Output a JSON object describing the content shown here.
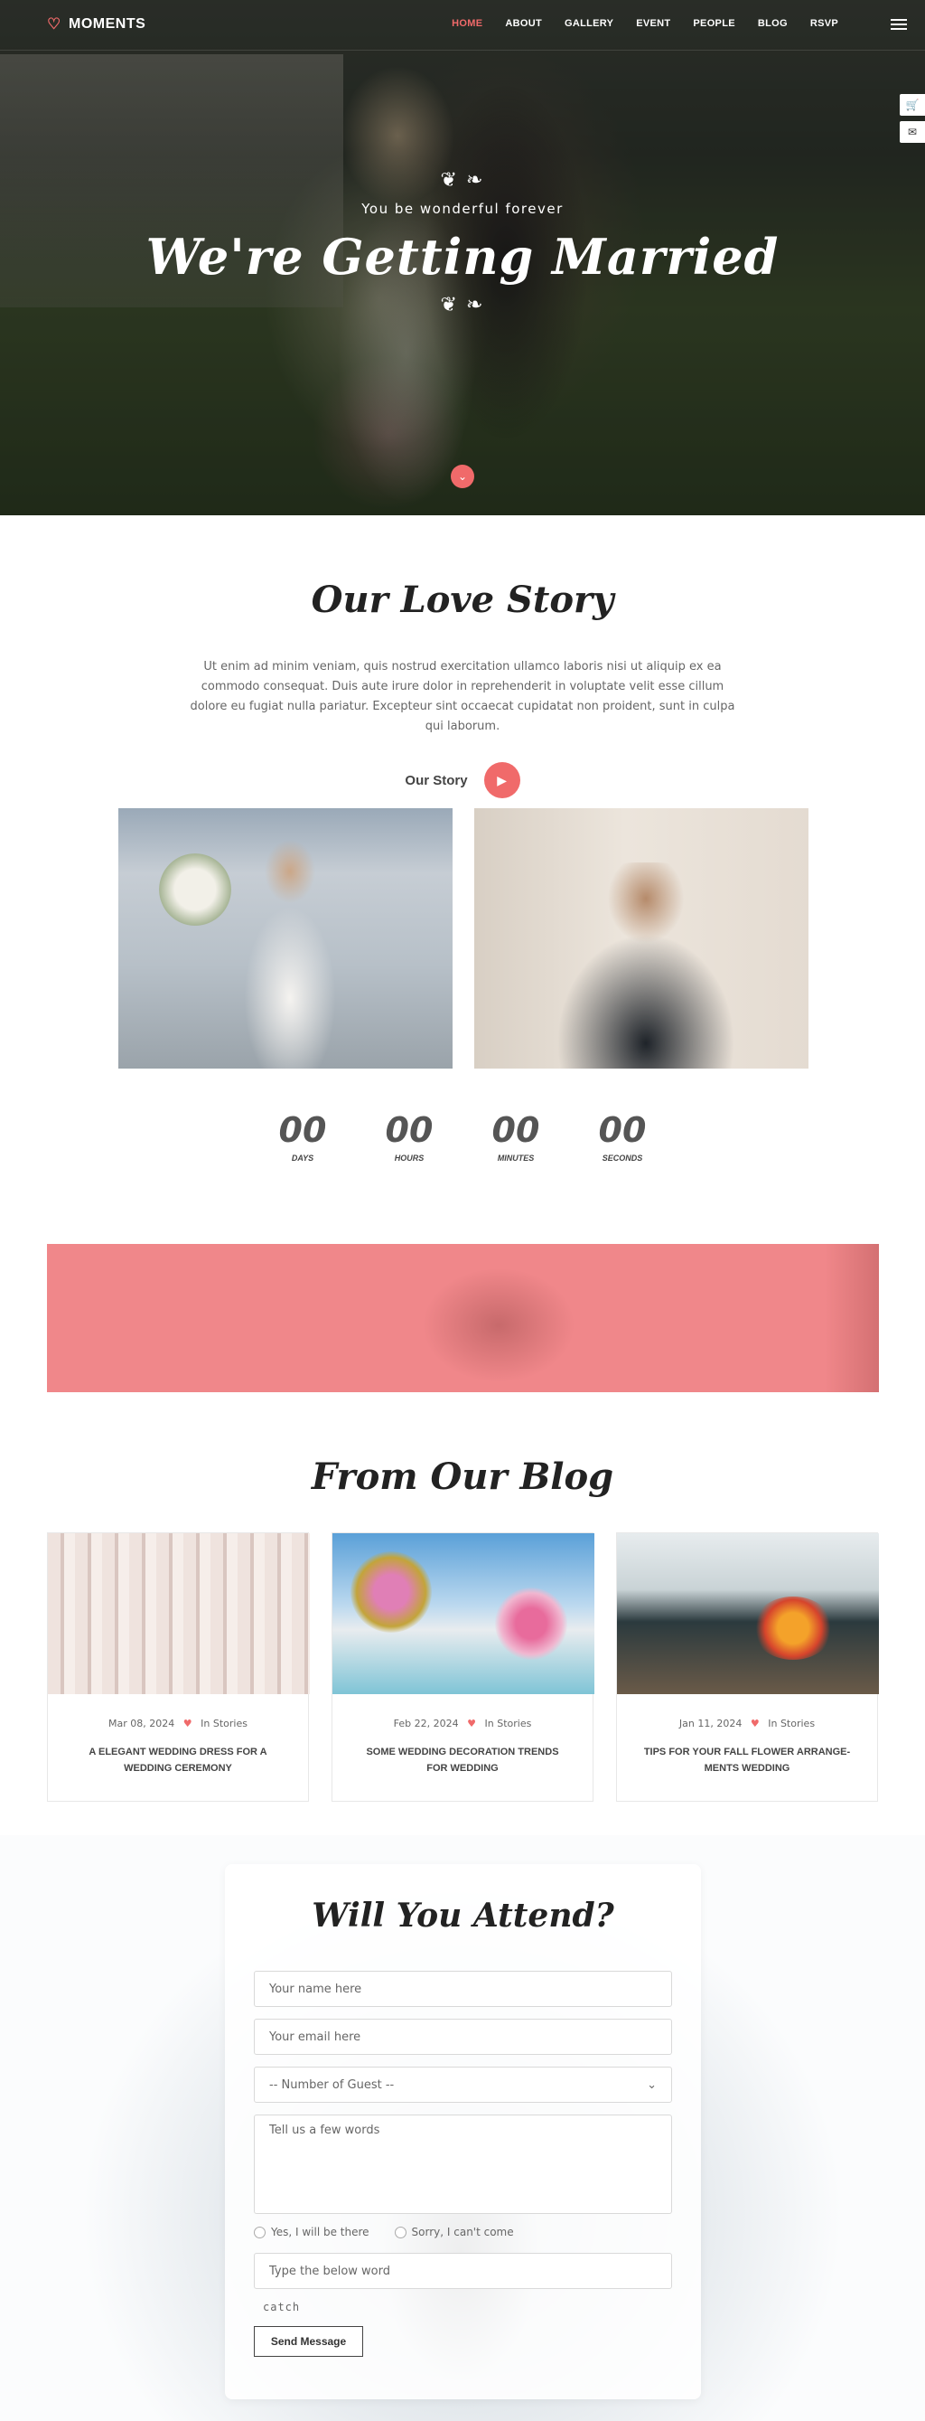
{
  "nav": {
    "brand": "MOMENTS",
    "items": [
      {
        "label": "HOME",
        "active": true
      },
      {
        "label": "ABOUT"
      },
      {
        "label": "GALLERY"
      },
      {
        "label": "EVENT"
      },
      {
        "label": "PEOPLE"
      },
      {
        "label": "BLOG"
      },
      {
        "label": "RSVP"
      }
    ]
  },
  "hero": {
    "subtitle": "You be wonderful forever",
    "title": "We're Getting Married"
  },
  "love": {
    "title": "Our Love Story",
    "text": "Ut enim ad minim veniam, quis nostrud exercitation ullamco laboris nisi ut aliquip ex ea commodo consequat. Duis aute irure dolor in reprehenderit in voluptate velit esse cillum dolore eu fugiat nulla pariatur. Excepteur sint occaecat cupidatat non proident, sunt in culpa qui laborum.",
    "story_label": "Our Story"
  },
  "countdown": [
    {
      "value": "00",
      "label": "DAYS"
    },
    {
      "value": "00",
      "label": "HOURS"
    },
    {
      "value": "00",
      "label": "MINUTES"
    },
    {
      "value": "00",
      "label": "SECONDS"
    }
  ],
  "blog": {
    "title": "From Our Blog",
    "posts": [
      {
        "date": "Mar 08, 2024",
        "category": "In Stories",
        "title": "A ELEGANT WEDDING DRESS FOR A WEDDING CEREMONY"
      },
      {
        "date": "Feb 22, 2024",
        "category": "In Stories",
        "title": "SOME WEDDING DECORATION TRENDS FOR WEDDING"
      },
      {
        "date": "Jan 11, 2024",
        "category": "In Stories",
        "title": "TIPS FOR YOUR FALL FLOWER ARRANGE-MENTS WEDDING"
      }
    ]
  },
  "rsvp": {
    "title": "Will You Attend?",
    "name_placeholder": "Your name here",
    "email_placeholder": "Your email here",
    "guests_selected": "-- Number of Guest --",
    "message_placeholder": "Tell us a few words",
    "radio_yes": "Yes, I will be there",
    "radio_no": "Sorry, I can't come",
    "captcha_placeholder": "Type the below word",
    "captcha_word": "catch",
    "submit": "Send Message"
  },
  "colors": {
    "accent": "#f06a6a",
    "banner": "#f0878a"
  }
}
